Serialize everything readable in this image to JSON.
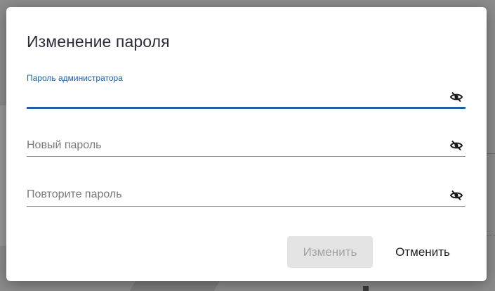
{
  "dialog": {
    "title": "Изменение пароля",
    "fields": [
      {
        "label": "Пароль администратора",
        "value": "",
        "state": "focused",
        "icon": "eye-off-icon"
      },
      {
        "placeholder": "Новый пароль",
        "value": "",
        "state": "empty",
        "icon": "eye-off-icon"
      },
      {
        "placeholder": "Повторите пароль",
        "value": "",
        "state": "empty",
        "icon": "eye-off-icon"
      }
    ],
    "buttons": {
      "change_label": "Изменить",
      "change_disabled": true,
      "cancel_label": "Отменить"
    }
  },
  "colors": {
    "accent": "#1f5fa0",
    "overlay": "#8c8c8c",
    "disabled_bg": "#e4e4e4",
    "disabled_text": "#a4a4a4"
  }
}
